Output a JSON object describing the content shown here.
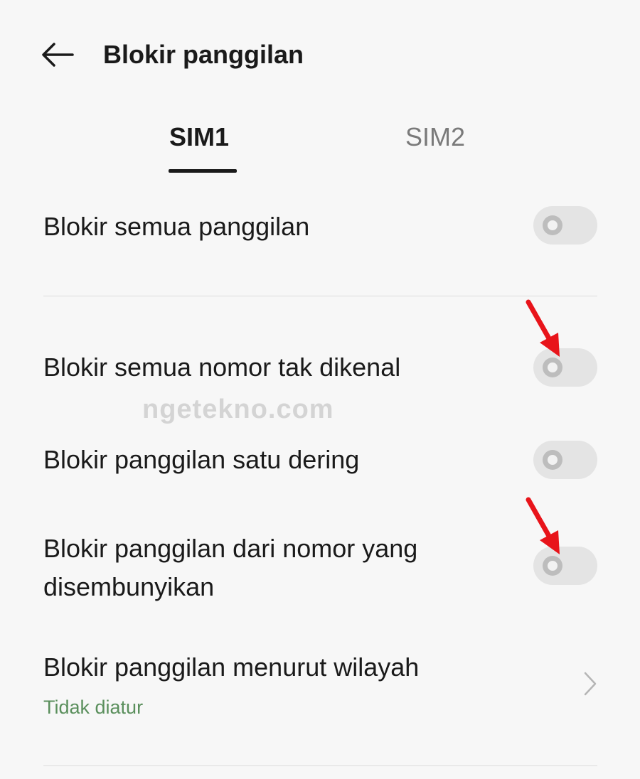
{
  "header": {
    "back_icon": "arrow-left-icon",
    "title": "Blokir panggilan"
  },
  "tabs": [
    {
      "label": "SIM1",
      "active": true
    },
    {
      "label": "SIM2",
      "active": false
    }
  ],
  "settings": [
    {
      "label": "Blokir semua panggilan",
      "enabled": false
    },
    {
      "label": "Blokir semua nomor tak dikenal",
      "enabled": false
    },
    {
      "label": "Blokir panggilan satu dering",
      "enabled": false
    },
    {
      "label": "Blokir panggilan dari nomor yang disembunyikan",
      "enabled": false
    }
  ],
  "region_block": {
    "label": "Blokir panggilan menurut wilayah",
    "status": "Tidak diatur",
    "icon": "chevron-right-icon"
  },
  "watermark": "ngetekno.com",
  "colors": {
    "background": "#f7f7f7",
    "toggle_off": "#e4e4e4",
    "sublabel_green": "#5a8f5c",
    "annotation_arrow": "#e8141a"
  }
}
